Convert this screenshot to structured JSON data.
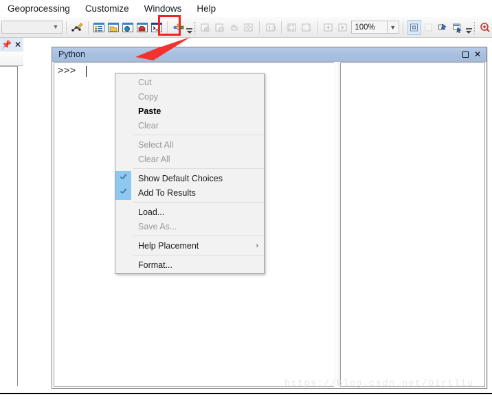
{
  "menubar": {
    "items": [
      {
        "label": "Geoprocessing"
      },
      {
        "label": "Customize"
      },
      {
        "label": "Windows"
      },
      {
        "label": "Help"
      }
    ]
  },
  "toolbar": {
    "combo_value": "",
    "zoom_value": "100%",
    "buttons": [
      {
        "name": "editor-tool",
        "enabled": true
      },
      {
        "name": "table-of-contents",
        "enabled": true
      },
      {
        "name": "catalog-window",
        "enabled": true
      },
      {
        "name": "search-window",
        "enabled": true
      },
      {
        "name": "arctoolbox-window",
        "enabled": true
      },
      {
        "name": "python-window",
        "enabled": true,
        "highlighted": true
      },
      {
        "name": "model-builder",
        "enabled": true
      },
      {
        "name": "zoom-in",
        "enabled": false
      },
      {
        "name": "zoom-out",
        "enabled": false
      },
      {
        "name": "pan",
        "enabled": false
      },
      {
        "name": "full-extent",
        "enabled": false
      },
      {
        "name": "fixed-zoom-in",
        "enabled": false
      },
      {
        "name": "fixed-zoom-out",
        "enabled": false
      },
      {
        "name": "go-back-extent",
        "enabled": false
      },
      {
        "name": "go-forward-extent",
        "enabled": false
      },
      {
        "name": "select-features",
        "enabled": true
      },
      {
        "name": "clear-selection",
        "enabled": false
      },
      {
        "name": "select-elements",
        "enabled": true
      },
      {
        "name": "identify",
        "enabled": true
      },
      {
        "name": "magnifier",
        "enabled": true
      }
    ]
  },
  "left_dock": {
    "pin_icon": "pushpin-icon",
    "close_icon": "close-icon"
  },
  "python_window": {
    "title": "Python",
    "restore_label": "❐",
    "close_label": "✕",
    "prompt": ">>>"
  },
  "context_menu": {
    "groups": [
      {
        "items": [
          {
            "label": "Cut",
            "state": "disabled",
            "checked": false,
            "submenu": false
          },
          {
            "label": "Copy",
            "state": "disabled",
            "checked": false,
            "submenu": false
          },
          {
            "label": "Paste",
            "state": "bold",
            "checked": false,
            "submenu": false
          },
          {
            "label": "Clear",
            "state": "disabled",
            "checked": false,
            "submenu": false
          }
        ]
      },
      {
        "items": [
          {
            "label": "Select All",
            "state": "disabled",
            "checked": false,
            "submenu": false
          },
          {
            "label": "Clear All",
            "state": "disabled",
            "checked": false,
            "submenu": false
          }
        ]
      },
      {
        "items": [
          {
            "label": "Show Default Choices",
            "state": "normal",
            "checked": true,
            "submenu": false
          },
          {
            "label": "Add To Results",
            "state": "normal",
            "checked": true,
            "submenu": false
          }
        ]
      },
      {
        "items": [
          {
            "label": "Load...",
            "state": "normal",
            "checked": false,
            "submenu": false
          },
          {
            "label": "Save As...",
            "state": "disabled",
            "checked": false,
            "submenu": false
          }
        ]
      },
      {
        "items": [
          {
            "label": "Help Placement",
            "state": "normal",
            "checked": false,
            "submenu": true,
            "arrow": "›"
          }
        ]
      },
      {
        "items": [
          {
            "label": "Format...",
            "state": "normal",
            "checked": false,
            "submenu": false
          }
        ]
      }
    ]
  },
  "annotations": {
    "arrow_color": "#f2322f",
    "highlight_rect_color": "#ee2222"
  },
  "watermark": {
    "text": "https://blog.csdn.net/Dirtliu"
  }
}
